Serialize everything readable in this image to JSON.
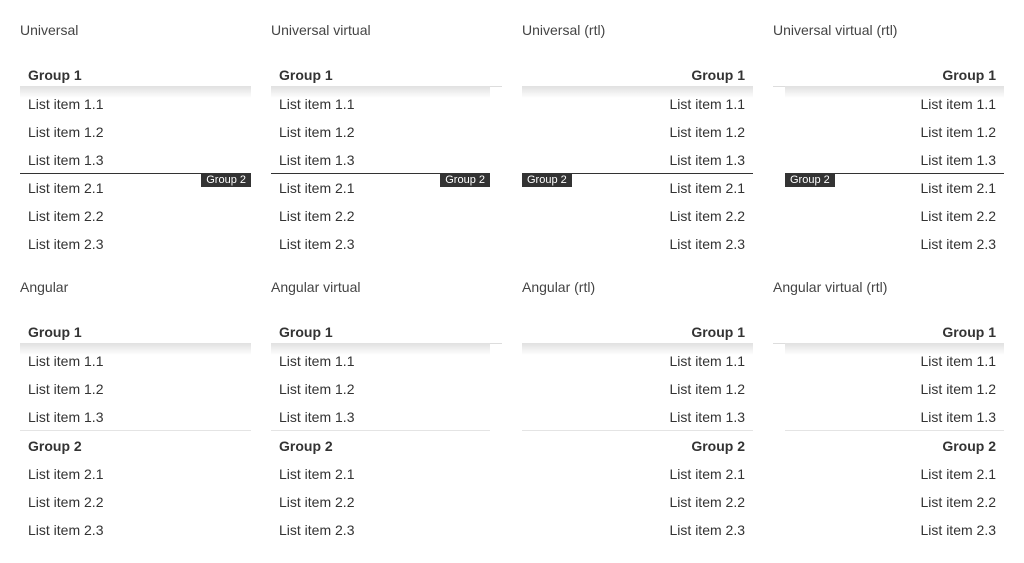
{
  "panels": {
    "universal": {
      "title": "Universal",
      "group1": "Group 1",
      "group2": "Group 2",
      "items1": [
        "List item 1.1",
        "List item 1.2",
        "List item 1.3"
      ],
      "items2": [
        "List item 2.1",
        "List item 2.2",
        "List item 2.3"
      ]
    },
    "universal_virtual": {
      "title": "Universal virtual",
      "group1": "Group 1",
      "group2": "Group 2",
      "items1": [
        "List item 1.1",
        "List item 1.2",
        "List item 1.3"
      ],
      "items2": [
        "List item 2.1",
        "List item 2.2",
        "List item 2.3"
      ]
    },
    "universal_rtl": {
      "title": "Universal (rtl)",
      "group1": "Group 1",
      "group2": "Group 2",
      "items1": [
        "List item 1.1",
        "List item 1.2",
        "List item 1.3"
      ],
      "items2": [
        "List item 2.1",
        "List item 2.2",
        "List item 2.3"
      ]
    },
    "universal_virtual_rtl": {
      "title": "Universal virtual (rtl)",
      "group1": "Group 1",
      "group2": "Group 2",
      "items1": [
        "List item 1.1",
        "List item 1.2",
        "List item 1.3"
      ],
      "items2": [
        "List item 2.1",
        "List item 2.2",
        "List item 2.3"
      ]
    },
    "angular": {
      "title": "Angular",
      "group1": "Group 1",
      "group2": "Group 2",
      "items1": [
        "List item 1.1",
        "List item 1.2",
        "List item 1.3"
      ],
      "items2": [
        "List item 2.1",
        "List item 2.2",
        "List item 2.3"
      ]
    },
    "angular_virtual": {
      "title": "Angular virtual",
      "group1": "Group 1",
      "group2": "Group 2",
      "items1": [
        "List item 1.1",
        "List item 1.2",
        "List item 1.3"
      ],
      "items2": [
        "List item 2.1",
        "List item 2.2",
        "List item 2.3"
      ]
    },
    "angular_rtl": {
      "title": "Angular (rtl)",
      "group1": "Group 1",
      "group2": "Group 2",
      "items1": [
        "List item 1.1",
        "List item 1.2",
        "List item 1.3"
      ],
      "items2": [
        "List item 2.1",
        "List item 2.2",
        "List item 2.3"
      ]
    },
    "angular_virtual_rtl": {
      "title": "Angular virtual (rtl)",
      "group1": "Group 1",
      "group2": "Group 2",
      "items1": [
        "List item 1.1",
        "List item 1.2",
        "List item 1.3"
      ],
      "items2": [
        "List item 2.1",
        "List item 2.2",
        "List item 2.3"
      ]
    }
  }
}
